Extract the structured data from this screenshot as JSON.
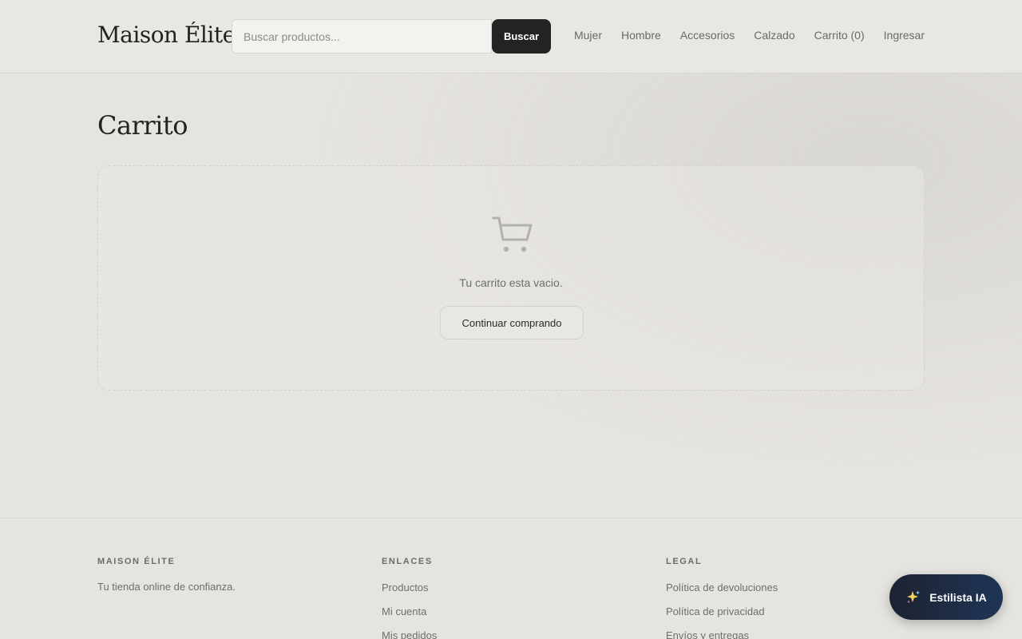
{
  "header": {
    "logo": "Maison Élite",
    "search": {
      "placeholder": "Buscar productos...",
      "value": "",
      "button_label": "Buscar"
    },
    "nav": [
      {
        "label": "Mujer"
      },
      {
        "label": "Hombre"
      },
      {
        "label": "Accesorios"
      },
      {
        "label": "Calzado"
      },
      {
        "label": "Carrito (0)"
      },
      {
        "label": "Ingresar"
      }
    ]
  },
  "main": {
    "title": "Carrito",
    "empty_message": "Tu carrito esta vacio.",
    "continue_label": "Continuar comprando",
    "cart_icon": "cart-icon"
  },
  "footer": {
    "brand": {
      "heading": "MAISON ÉLITE",
      "tagline": "Tu tienda online de confianza."
    },
    "links": {
      "heading": "ENLACES",
      "items": [
        "Productos",
        "Mi cuenta",
        "Mis pedidos"
      ]
    },
    "legal": {
      "heading": "LEGAL",
      "items": [
        "Política de devoluciones",
        "Política de privacidad",
        "Envíos y entregas"
      ]
    }
  },
  "assistant": {
    "label": "Estilista IA",
    "icon": "sparkle-icon"
  },
  "colors": {
    "primary_button": "#232323",
    "assistant_gradient_start": "#1d2230",
    "assistant_gradient_end": "#1f3557",
    "background": "#e6e4df"
  }
}
